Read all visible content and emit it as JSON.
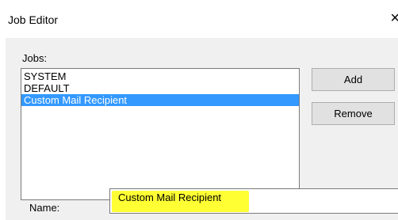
{
  "window": {
    "title": "Job Editor",
    "close_glyph": "×"
  },
  "jobs": {
    "label": "Jobs:",
    "items": [
      {
        "label": "SYSTEM",
        "selected": false
      },
      {
        "label": "DEFAULT",
        "selected": false
      },
      {
        "label": "Custom Mail Recipient",
        "selected": true
      }
    ]
  },
  "buttons": {
    "add_label": "Add",
    "remove_label": "Remove"
  },
  "name_field": {
    "label": "Name:",
    "value": "Custom Mail Recipient",
    "highlight_color": "#ffff33"
  },
  "colors": {
    "selection": "#3399ff",
    "dialog_bg": "#f0f0f0"
  }
}
